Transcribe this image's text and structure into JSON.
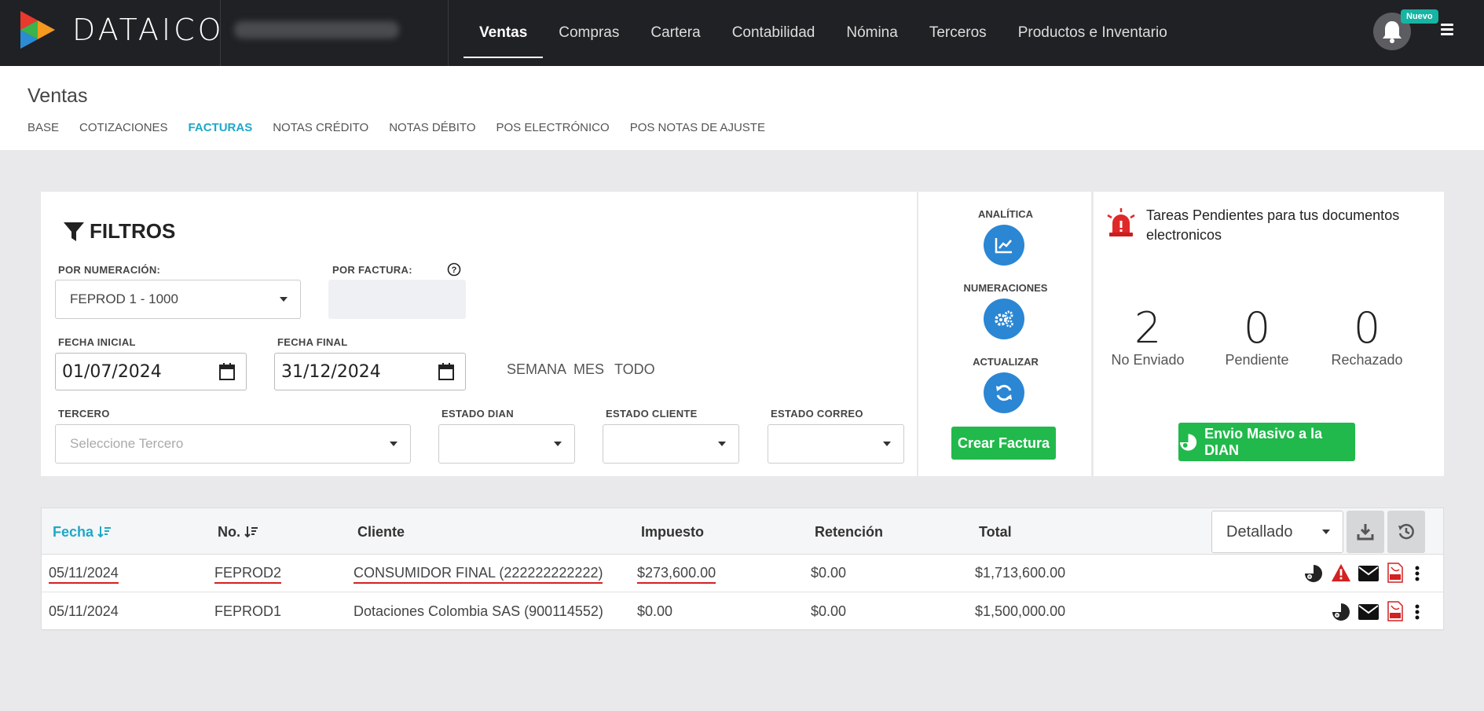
{
  "app": {
    "brand": "DATAICO",
    "notification_badge": "Nuevo"
  },
  "nav": [
    "Ventas",
    "Compras",
    "Cartera",
    "Contabilidad",
    "Nómina",
    "Terceros",
    "Productos e Inventario"
  ],
  "page": {
    "title": "Ventas",
    "tabs": [
      "BASE",
      "COTIZACIONES",
      "FACTURAS",
      "NOTAS CRÉDITO",
      "NOTAS DÉBITO",
      "POS ELECTRÓNICO",
      "POS NOTAS DE AJUSTE"
    ]
  },
  "filters": {
    "title": "FILTROS",
    "numeracion_label": "POR NUMERACIÓN:",
    "numeracion_value": "FEPROD 1 - 1000",
    "factura_label": "POR FACTURA:",
    "fecha_inicial_label": "FECHA INICIAL",
    "fecha_inicial_value": "01/07/2024",
    "fecha_final_label": "FECHA FINAL",
    "fecha_final_value": "31/12/2024",
    "quick": [
      "SEMANA",
      "MES",
      "TODO"
    ],
    "tercero_label": "TERCERO",
    "tercero_placeholder": "Seleccione Tercero",
    "estado_dian_label": "ESTADO DIAN",
    "estado_cliente_label": "ESTADO CLIENTE",
    "estado_correo_label": "ESTADO CORREO"
  },
  "actions": {
    "analitica": "ANALÍTICA",
    "numeraciones": "NUMERACIONES",
    "actualizar": "ACTUALIZAR",
    "crear_factura": "Crear Factura"
  },
  "tareas": {
    "title": "Tareas Pendientes para tus documentos electronicos",
    "counters": [
      {
        "value": "2",
        "label": "No Enviado"
      },
      {
        "value": "0",
        "label": "Pendiente"
      },
      {
        "value": "0",
        "label": "Rechazado"
      }
    ],
    "envio_button": "Envio Masivo a la DIAN"
  },
  "table": {
    "headers": {
      "fecha": "Fecha",
      "no": "No.",
      "cliente": "Cliente",
      "impuesto": "Impuesto",
      "retencion": "Retención",
      "total": "Total"
    },
    "view_select": "Detallado",
    "rows": [
      {
        "fecha": "05/11/2024",
        "no": "FEPROD2",
        "cliente": "CONSUMIDOR FINAL (222222222222)",
        "impuesto": "$273,600.00",
        "retencion": "$0.00",
        "total": "$1,713,600.00"
      },
      {
        "fecha": "05/11/2024",
        "no": "FEPROD1",
        "cliente": "Dotaciones Colombia SAS (900114552)",
        "impuesto": "$0.00",
        "retencion": "$0.00",
        "total": "$1,500,000.00"
      }
    ]
  },
  "colors": {
    "accent": "#1fa8c7",
    "primary_blue": "#2b86d4",
    "green": "#21b94b",
    "topbar": "#202124",
    "alert_red": "#d42121"
  }
}
